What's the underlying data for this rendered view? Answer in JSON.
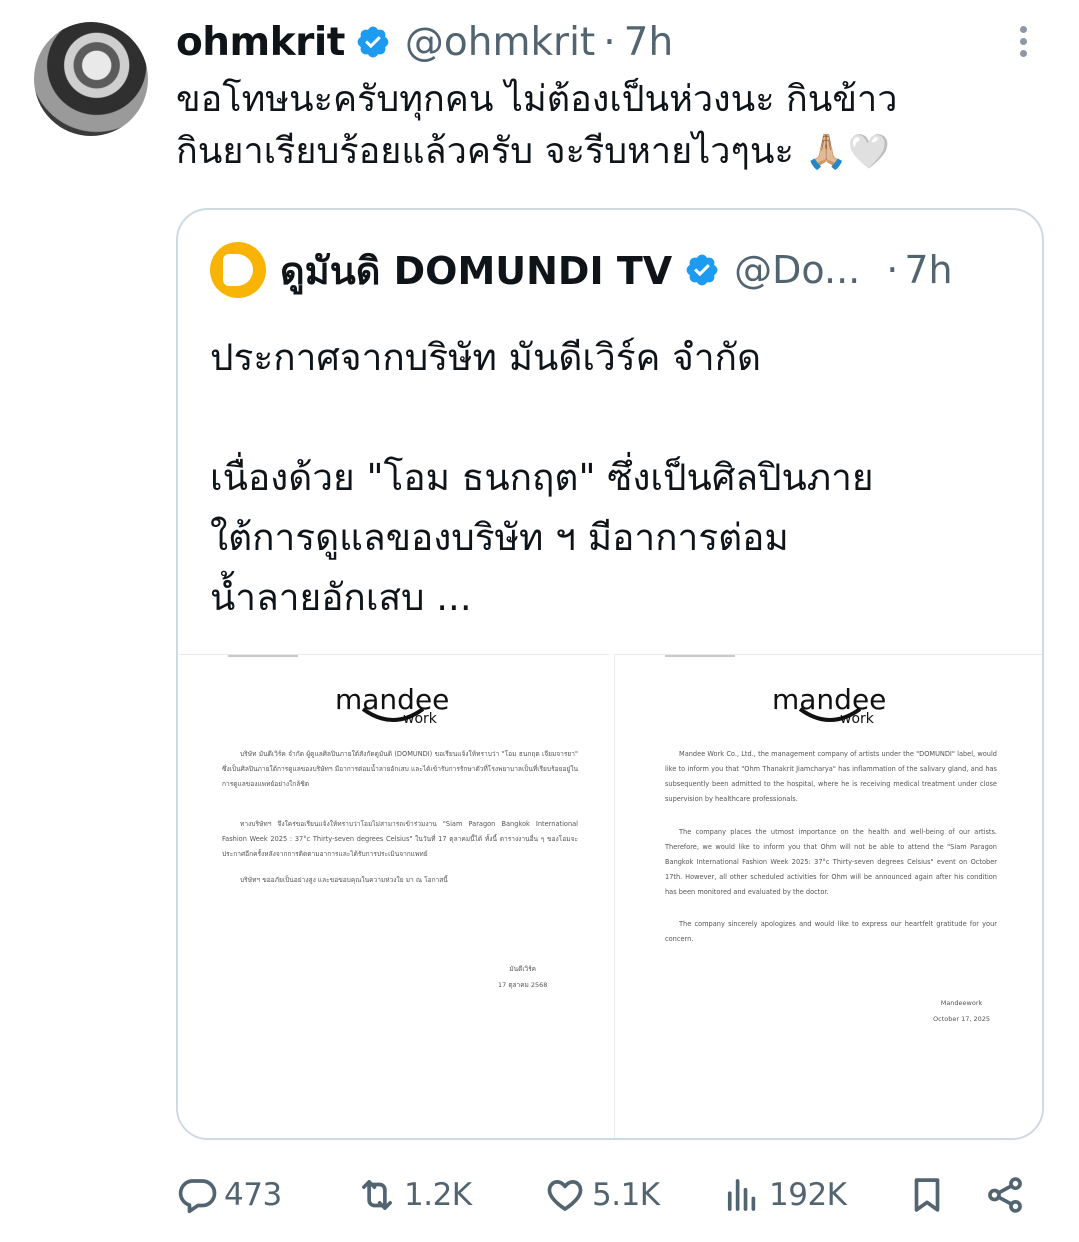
{
  "tweet": {
    "author_name": "ohmkrit",
    "handle": "@ohmkrit",
    "dot": "·",
    "time": "7h",
    "text": "ขอโทษนะครับทุกคน ไม่ต้องเป็นห่วงนะ กินข้าว\nกินยาเรียบร้อยแล้วครับ จะรีบหายไวๆนะ ",
    "emoji": "🙏🏼🤍"
  },
  "quote": {
    "author_name": "ดูมันดิ DOMUNDI TV",
    "handle": "@Do...",
    "dot": "·",
    "time": "7h",
    "text": "ประกาศจากบริษัท มันดีเวิร์ค จำกัด\n\nเนื่องด้วย \"โอม ธนกฤต\" ซึ่งเป็นศิลปินภาย\nใต้การดูแลของบริษัท ฯ มีอาการต่อม\nน้ำลายอักเสบ ...",
    "docs": {
      "logo_text": "mandee",
      "logo_sub": "work",
      "th_p1": "บริษัท มันดีเวิร์ค จำกัด ผู้ดูแลศิลปินภายใต้สังกัดดูมันดิ (DOMUNDI) ขอเรียนแจ้งให้ทราบว่า \"โอม ธนกฤต เจียมจารยา\" ซึ่งเป็นศิลปินภายใต้การดูแลของบริษัทฯ มีอาการต่อมน้ำลายอักเสบ และได้เข้ารับการรักษาตัวที่โรงพยาบาลเป็นที่เรียบร้อยอยู่ในการดูแลของแพทย์อย่างใกล้ชิด",
      "th_p2": "ทางบริษัทฯ จึงใคร่ขอเรียนแจ้งให้ทราบว่าโอมไม่สามารถเข้าร่วมงาน \"Siam Paragon Bangkok International Fashion Week 2025 : 37°c Thirty-seven degrees Celsius\" ในวันที่ 17 ตุลาคมนี้ได้ ทั้งนี้ ตารางงานอื่น ๆ ของโอมจะประกาศอีกครั้งหลังจากการติดตามอาการและได้รับการประเมินจากแพทย์",
      "th_p3": "บริษัทฯ ขออภัยเป็นอย่างสูง และขอขอบคุณในความห่วงใย มา ณ โอกาสนี้",
      "th_sig_name": "มันดีเวิร์ค",
      "th_sig_date": "17 ตุลาคม 2568",
      "en_p1": "Mandee Work Co., Ltd., the management company of artists under the \"DOMUNDI\" label, would like to inform you that \"Ohm Thanakrit Jiamcharya\" has inflammation of the salivary gland, and has subsequently been admitted to the hospital, where he is receiving medical treatment under close supervision by healthcare professionals.",
      "en_p2": "The company places the utmost importance on the health and well-being of our artists. Therefore, we would like to inform you that Ohm will not be able to attend the \"Siam Paragon Bangkok International Fashion Week 2025: 37°c Thirty-seven degrees Celsius\" event on October 17th. However, all other scheduled activities for Ohm will be announced again after his condition has been monitored and evaluated by the doctor.",
      "en_p3": "The company sincerely apologizes and would like to express our heartfelt gratitude for your concern.",
      "en_sig_name": "Mandeework",
      "en_sig_date": "October 17, 2025"
    }
  },
  "actions": {
    "replies": "473",
    "reposts": "1.2K",
    "likes": "5.1K",
    "views": "192K"
  },
  "colors": {
    "verified": "#1d9bf0",
    "muted": "#536471",
    "border": "#cfd9de",
    "quote_avatar": "#f8b400"
  }
}
